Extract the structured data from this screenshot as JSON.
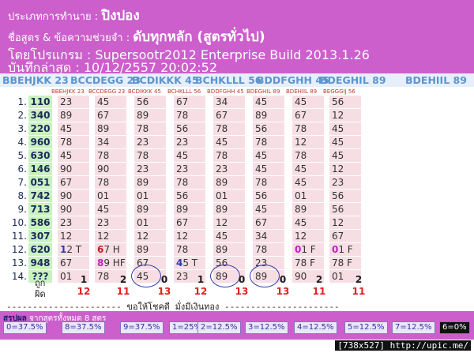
{
  "header": {
    "line1_label": "ประเภทการทำนาย : ",
    "line1_value": "ปิงปอง",
    "line2_label": "ชื่อสูตร & ข้อความช่วยจำ : ",
    "line2_value": "ดับทุกหลัก (สูตรทั่วไป)",
    "line3": "โดยโปรแกรม : Supersootr2012 Enterprise Build 2013.1.26",
    "line4": "บันทึกล่าสุด : 10/12/2557 20:02:52"
  },
  "codes": [
    "BBEHJKK 23",
    "BCCDEGG 23",
    "BCDIKKK 45",
    "BCHKLLL 56",
    "BDDFGHH 45",
    "BDEGHIL 89",
    "BDEHIIL 89"
  ],
  "col_headers": [
    "BBEHJKK 23",
    "BCCDEGG 23",
    "BCDIKKK 45",
    "BCHKLLL 56",
    "BDDFGHH 45",
    "BDEGHIL 89",
    "BDEHIIL 89",
    "BEGGGIJ 56"
  ],
  "rows": [
    {
      "n": "1.",
      "num": "110",
      "v": [
        "23",
        "45",
        "56",
        "67",
        "34",
        "45",
        "45",
        "56"
      ]
    },
    {
      "n": "2.",
      "num": "340",
      "v": [
        "89",
        "67",
        "89",
        "78",
        "67",
        "89",
        "67",
        "12"
      ]
    },
    {
      "n": "3.",
      "num": "220",
      "v": [
        "45",
        "89",
        "78",
        "56",
        "78",
        "56",
        "78",
        "45"
      ]
    },
    {
      "n": "4.",
      "num": "960",
      "v": [
        "78",
        "34",
        "23",
        "23",
        "45",
        "78",
        "12",
        "45"
      ]
    },
    {
      "n": "5.",
      "num": "630",
      "v": [
        "45",
        "78",
        "78",
        "45",
        "78",
        "45",
        "78",
        "45"
      ]
    },
    {
      "n": "6.",
      "num": "146",
      "v": [
        "90",
        "90",
        "23",
        "23",
        "23",
        "45",
        "45",
        "12"
      ]
    },
    {
      "n": "7.",
      "num": "051",
      "v": [
        "67",
        "78",
        "89",
        "78",
        "89",
        "78",
        "45",
        "23"
      ]
    },
    {
      "n": "8.",
      "num": "742",
      "v": [
        "90",
        "01",
        "01",
        "56",
        "01",
        "56",
        "01",
        "56"
      ]
    },
    {
      "n": "9.",
      "num": "713",
      "v": [
        "90",
        "45",
        "89",
        "89",
        "89",
        "45",
        "89",
        "56"
      ]
    },
    {
      "n": "10.",
      "num": "586",
      "v": [
        "23",
        "23",
        "01",
        "67",
        "12",
        "67",
        "45",
        "12"
      ]
    },
    {
      "n": "11.",
      "num": "307",
      "v": [
        "12",
        "12",
        "12",
        "12",
        "45",
        "34",
        "12",
        "67"
      ]
    },
    {
      "n": "12.",
      "num": "620",
      "v": [
        "12 T",
        "67 H",
        "89",
        "78",
        "89",
        "78",
        "01 F",
        "01 F"
      ]
    },
    {
      "n": "13.",
      "num": "948",
      "v": [
        "67",
        "89 HF",
        "67",
        "45 T",
        "56",
        "23",
        "78 F",
        "78 F"
      ]
    },
    {
      "n": "14.",
      "num": "???",
      "v": [
        "01",
        "78",
        "45",
        "23",
        "89",
        "89",
        "90",
        "01"
      ]
    }
  ],
  "marks": {
    "r12": [
      "1",
      "6",
      "",
      "",
      "",
      "",
      "0",
      "0"
    ],
    "r13": [
      "",
      "8",
      "",
      "4",
      "",
      "",
      "8",
      "8"
    ]
  },
  "totals": {
    "label_hit": "ถูก",
    "label_miss": "ผิด",
    "hit": [
      "1",
      "2",
      "0",
      "1",
      "0",
      "0",
      "2",
      "2"
    ],
    "miss": [
      "12",
      "11",
      "13",
      "12",
      "13",
      "13",
      "11",
      "11"
    ]
  },
  "blessing": "---------------------- ขอให้โชคดี มั่งมีเงินทอง ----------------------",
  "summary": {
    "title": "สรุปผล",
    "subtitle": " จากสูตรทั้งหมด 8 สูตร",
    "chips": [
      "0=37.5%",
      "8=37.5%",
      "9=37.5%",
      "1=25%",
      "2=12.5%",
      "3=12.5%",
      "4=12.5%",
      "5=12.5%",
      "7=12.5%",
      "6=0%"
    ]
  },
  "footer": {
    "watermark": "[738x527] http://upic.me/"
  }
}
